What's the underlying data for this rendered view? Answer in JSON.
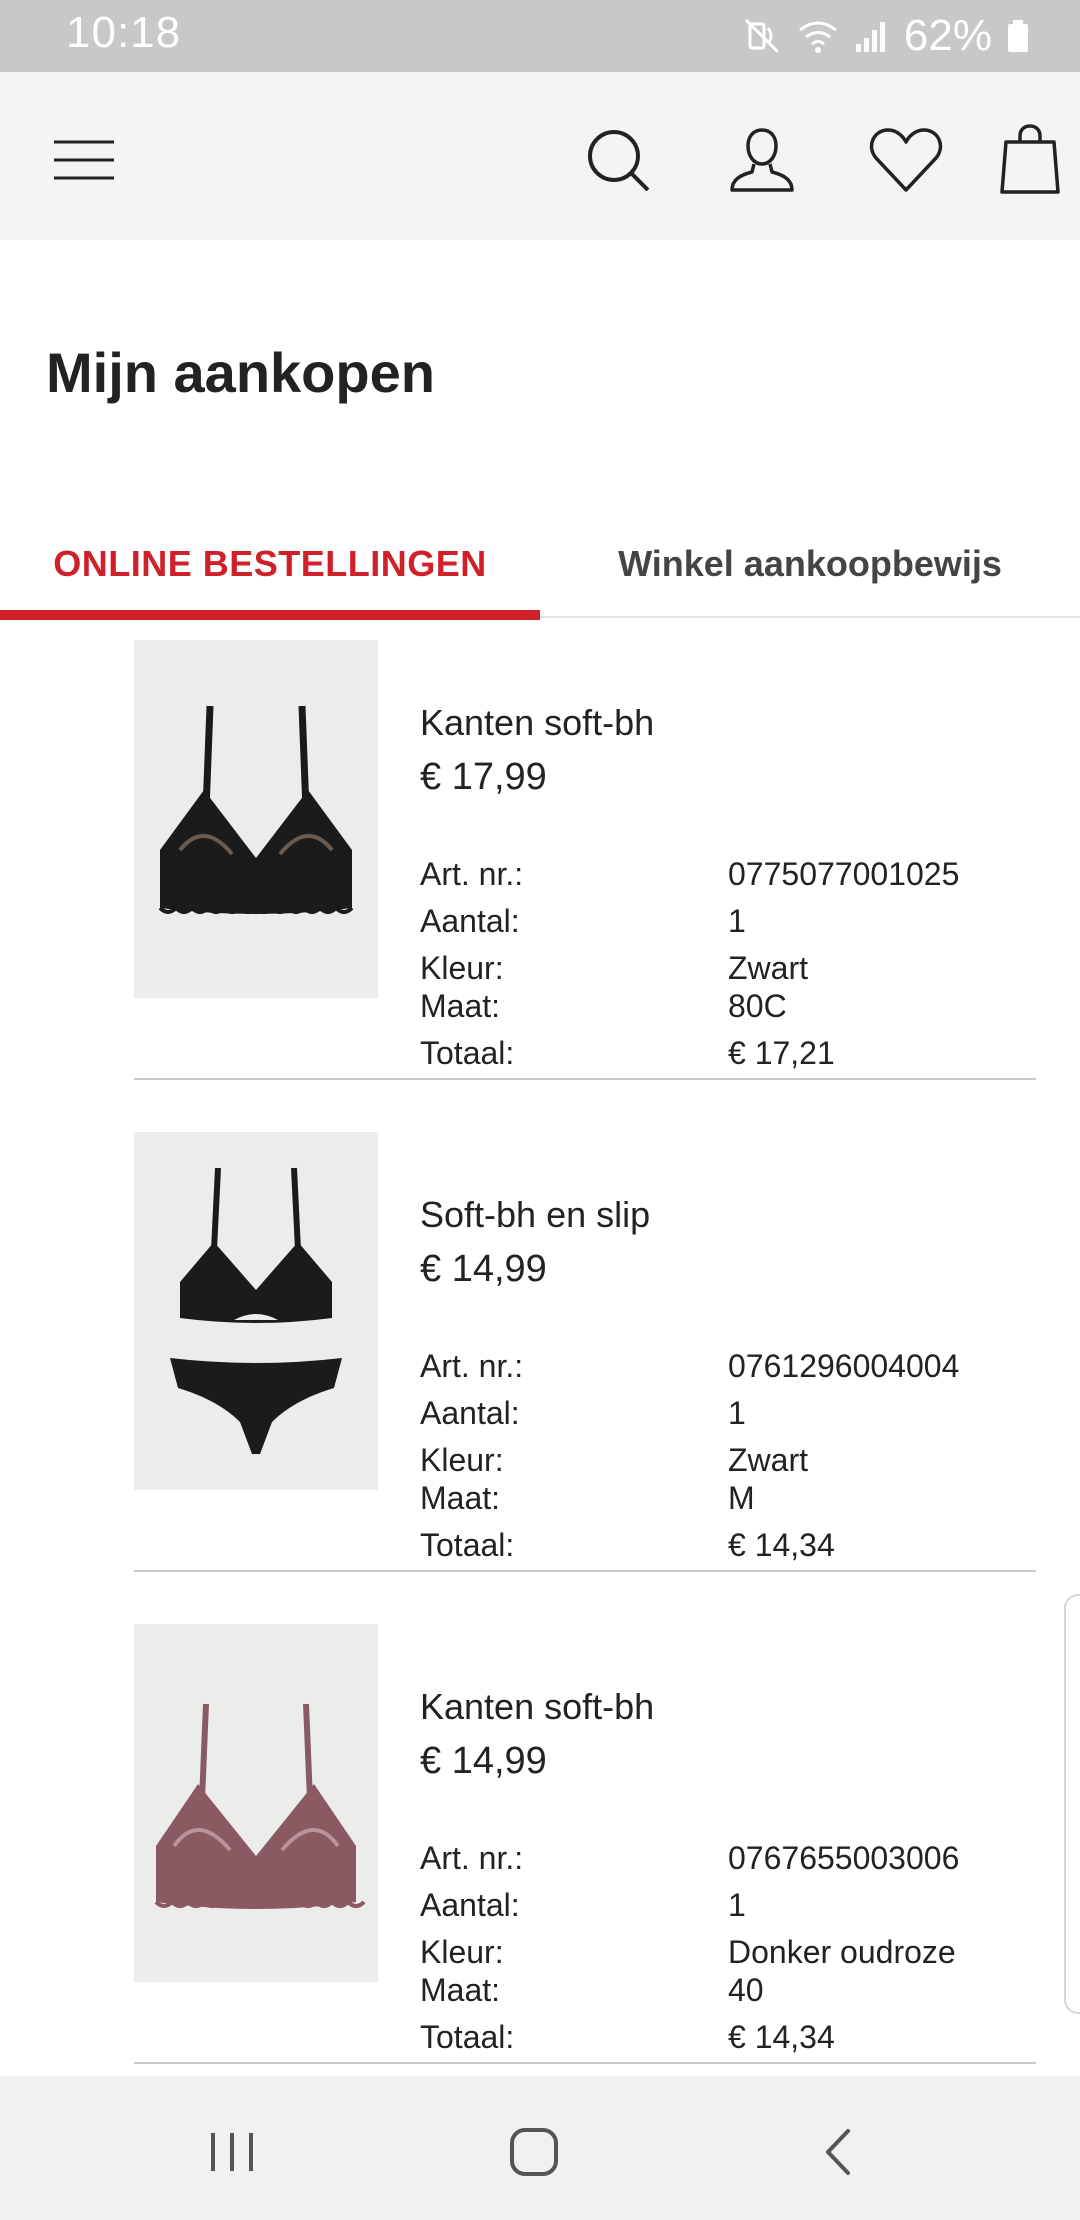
{
  "status_bar": {
    "time": "10:18",
    "battery": "62%"
  },
  "header": {
    "icons": [
      "menu-icon",
      "search-icon",
      "account-icon",
      "favorites-icon",
      "shopping-bag-icon"
    ]
  },
  "page": {
    "title": "Mijn aankopen"
  },
  "tabs": [
    {
      "label": "ONLINE BESTELLINGEN",
      "active": true
    },
    {
      "label": "Winkel aankoopbewijs",
      "active": false
    }
  ],
  "labels": {
    "art_nr": "Art. nr.:",
    "quantity": "Aantal:",
    "color": "Kleur:",
    "size": "Maat:",
    "total": "Totaal:"
  },
  "orders": [
    {
      "name": "Kanten soft-bh",
      "price": "€ 17,99",
      "art_nr": "0775077001025",
      "quantity": "1",
      "color": "Zwart",
      "size": "80C",
      "total": "€ 17,21",
      "image": "black-lace-bra"
    },
    {
      "name": "Soft-bh en slip",
      "price": "€ 14,99",
      "art_nr": "0761296004004",
      "quantity": "1",
      "color": "Zwart",
      "size": "M",
      "total": "€ 14,34",
      "image": "black-bra-and-brief-set"
    },
    {
      "name": "Kanten soft-bh",
      "price": "€ 14,99",
      "art_nr": "0767655003006",
      "quantity": "1",
      "color": "Donker oudroze",
      "size": "40",
      "total": "€ 14,34",
      "image": "dusty-pink-lace-bra"
    }
  ],
  "colors": {
    "accent": "#d0202a",
    "header_bg": "#f4f4f4",
    "status_bar_bg": "#c8c8c8",
    "thumb_bg": "#ececea",
    "pink_product": "#8a5a63"
  },
  "nav_bar": {
    "icons": [
      "recent-apps-icon",
      "home-icon",
      "back-icon"
    ]
  }
}
